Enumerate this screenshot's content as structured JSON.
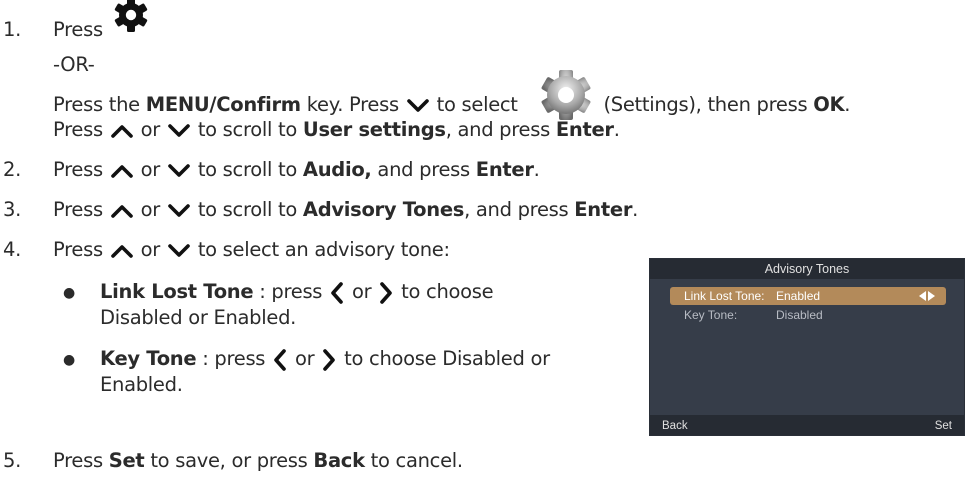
{
  "steps": [
    {
      "num": "1.",
      "press": "Press",
      "or_label": "-OR-",
      "l3_a": "Press the ",
      "l3_menu": "MENU/Confirm",
      "l3_b": " key. Press",
      "l3_c": "to select",
      "l3_d": "(Settings), then press ",
      "l3_ok": "OK",
      "l3_e": ".",
      "l4_a": "Press",
      "l4_or": "or",
      "l4_b": "to scroll to ",
      "l4_bold": "User settings",
      "l4_c": ", and press ",
      "l4_enter": "Enter",
      "l4_d": "."
    },
    {
      "num": "2.",
      "a": "Press",
      "or": "or",
      "b": "to scroll to ",
      "bold": "Audio,",
      "c": " and press ",
      "enter": "Enter",
      "d": "."
    },
    {
      "num": "3.",
      "a": "Press",
      "or": "or",
      "b": "to scroll to ",
      "bold": "Advisory Tones",
      "c": ", and press ",
      "enter": "Enter",
      "d": "."
    },
    {
      "num": "4.",
      "a": "Press",
      "or": "or",
      "b": "to select an advisory tone:"
    },
    {
      "num": "5.",
      "a": "Press ",
      "set": "Set",
      "b": " to save, or press ",
      "back": "Back",
      "c": " to cancel."
    }
  ],
  "bullets": [
    {
      "symbol": "●",
      "bold": "Link Lost Tone",
      "a": " : press",
      "or": "or",
      "b": "to  choose",
      "cont": "Disabled or Enabled."
    },
    {
      "symbol": "●",
      "bold": "Key Tone",
      "a": " : press",
      "or": "or",
      "b": "to  choose Disabled or",
      "cont": "Enabled."
    }
  ],
  "screen": {
    "title": "Advisory Tones",
    "rows": [
      {
        "label": "Link Lost Tone:",
        "value": "Enabled",
        "selected": true
      },
      {
        "label": "Key Tone:",
        "value": "Disabled",
        "selected": false
      }
    ],
    "footer_left": "Back",
    "footer_right": "Set"
  },
  "icons": {
    "settings_small": "gear-icon",
    "settings_large": "gear-icon",
    "up": "chevron-up-icon",
    "down": "chevron-down-icon",
    "left": "chevron-left-icon",
    "right": "chevron-right-icon"
  }
}
